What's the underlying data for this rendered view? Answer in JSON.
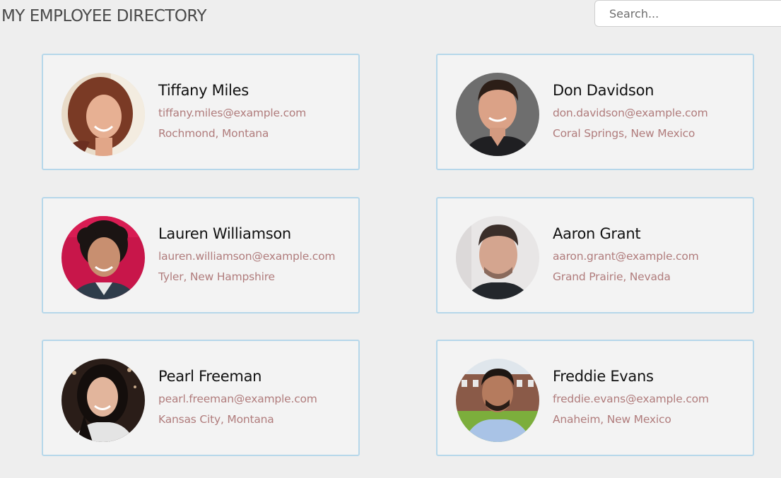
{
  "header": {
    "title": "MY EMPLOYEE DIRECTORY",
    "search_placeholder": "Search..."
  },
  "employees": [
    {
      "name": "Tiffany Miles",
      "email": "tiffany.miles@example.com",
      "location": "Rochmond, Montana"
    },
    {
      "name": "Don Davidson",
      "email": "don.davidson@example.com",
      "location": "Coral Springs, New Mexico"
    },
    {
      "name": "Lauren Williamson",
      "email": "lauren.williamson@example.com",
      "location": "Tyler, New Hampshire"
    },
    {
      "name": "Aaron Grant",
      "email": "aaron.grant@example.com",
      "location": "Grand Prairie, Nevada"
    },
    {
      "name": "Pearl Freeman",
      "email": "pearl.freeman@example.com",
      "location": "Kansas City, Montana"
    },
    {
      "name": "Freddie Evans",
      "email": "freddie.evans@example.com",
      "location": "Anaheim, New Mexico"
    }
  ]
}
